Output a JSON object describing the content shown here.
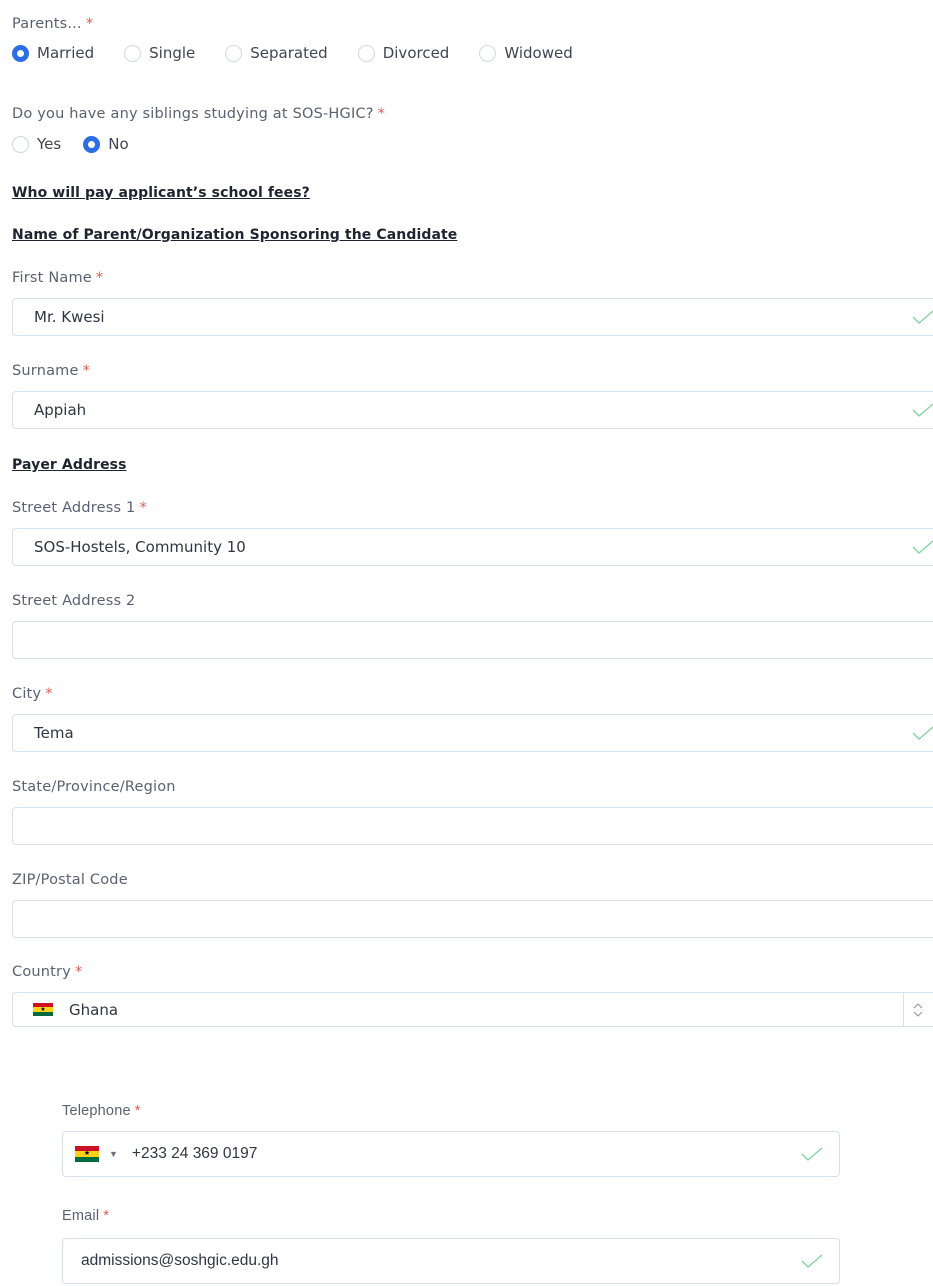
{
  "parents": {
    "label": "Parents...",
    "required": "*",
    "options": [
      {
        "label": "Married",
        "selected": true
      },
      {
        "label": "Single",
        "selected": false
      },
      {
        "label": "Separated",
        "selected": false
      },
      {
        "label": "Divorced",
        "selected": false
      },
      {
        "label": "Widowed",
        "selected": false
      }
    ]
  },
  "siblings": {
    "label": "Do you have any siblings studying at SOS-HGIC?",
    "required": "*",
    "options": [
      {
        "label": "Yes",
        "selected": false
      },
      {
        "label": "No",
        "selected": true
      }
    ]
  },
  "headings": {
    "fees": "Who will pay applicant’s school fees?",
    "sponsor": "Name of Parent/Organization Sponsoring the Candidate",
    "payer_address": "Payer Address"
  },
  "fields": {
    "first_name": {
      "label": "First Name",
      "required": "*",
      "value": "Mr. Kwesi"
    },
    "surname": {
      "label": "Surname",
      "required": "*",
      "value": "Appiah"
    },
    "street1": {
      "label": "Street Address 1",
      "required": "*",
      "value": "SOS-Hostels, Community 10"
    },
    "street2": {
      "label": "Street Address 2",
      "value": ""
    },
    "city": {
      "label": "City",
      "required": "*",
      "value": "Tema"
    },
    "state": {
      "label": "State/Province/Region",
      "value": ""
    },
    "zip": {
      "label": "ZIP/Postal Code",
      "value": ""
    },
    "country": {
      "label": "Country",
      "required": "*",
      "value": "Ghana"
    },
    "telephone": {
      "label": "Telephone",
      "required": "*",
      "value": "+233 24 369 0197"
    },
    "email": {
      "label": "Email",
      "required": "*",
      "value": "admissions@soshgic.edu.gh"
    }
  },
  "colors": {
    "accent": "#2d6ee6",
    "required": "#e85a4f",
    "valid_check": "#7fd3a0",
    "field_border": "#d5e0ec"
  },
  "icons": {
    "valid": "check-icon",
    "country_flag": "ghana-flag-icon",
    "select_arrows": "chevron-up-down-icon",
    "phone_dropdown": "caret-down-icon"
  }
}
